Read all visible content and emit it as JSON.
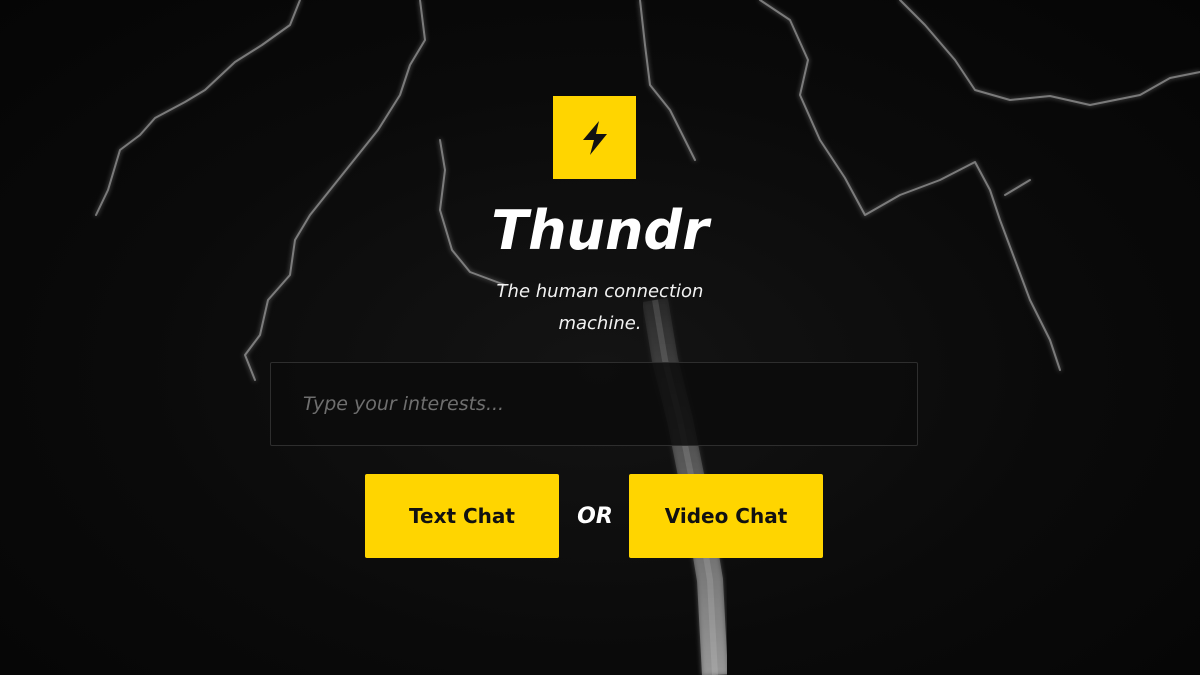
{
  "app": {
    "name": "Thundr",
    "tagline": "The human connection machine.",
    "accent_color": "#ffd500",
    "background_color": "#070707"
  },
  "logo": {
    "icon": "lightning-bolt-icon"
  },
  "search": {
    "placeholder": "Type your interests...",
    "value": ""
  },
  "actions": {
    "text_chat_label": "Text Chat",
    "separator": "OR",
    "video_chat_label": "Video Chat"
  }
}
